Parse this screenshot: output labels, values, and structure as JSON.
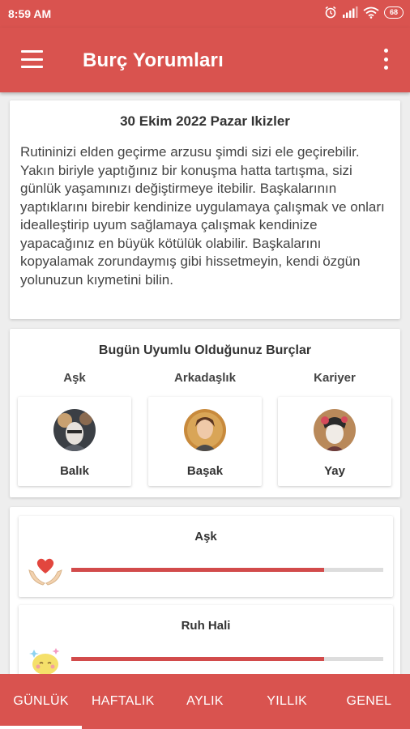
{
  "status_bar": {
    "time": "8:59 AM",
    "battery": "68"
  },
  "app_bar": {
    "title": "Burç Yorumları"
  },
  "horoscope": {
    "title": "30 Ekim 2022 Pazar Ikizler",
    "text": "Rutininizi elden geçirme arzusu şimdi sizi ele geçirebilir. Yakın biriyle yaptığınız bir konuşma hatta tartışma, sizi günlük yaşamınızı değiştirmeye itebilir. Başkalarının yaptıklarını birebir kendinize uygulamaya çalışmak ve onları idealleştirip uyum sağlamaya çalışmak kendinize yapacağınız en büyük kötülük olabilir. Başkalarını kopyalamak zorundaymış gibi hissetmeyin, kendi özgün yolunuzun kıymetini bilin."
  },
  "compatibility": {
    "title": "Bugün Uyumlu Olduğunuz Burçlar",
    "items": [
      {
        "category": "Aşk",
        "sign": "Balık"
      },
      {
        "category": "Arkadaşlık",
        "sign": "Başak"
      },
      {
        "category": "Kariyer",
        "sign": "Yay"
      }
    ]
  },
  "meters": [
    {
      "label": "Aşk",
      "value": 0.81,
      "icon": "heart-hands-icon"
    },
    {
      "label": "Ruh Hali",
      "value": 0.81,
      "icon": "mood-face-icon"
    }
  ],
  "tabs": [
    "GÜNLÜK",
    "HAFTALIK",
    "AYLIK",
    "YILLIK",
    "GENEL"
  ],
  "active_tab": 0,
  "colors": {
    "primary": "#d9534f",
    "meter_fill": "#d24b4b",
    "meter_track": "#dddddd"
  }
}
